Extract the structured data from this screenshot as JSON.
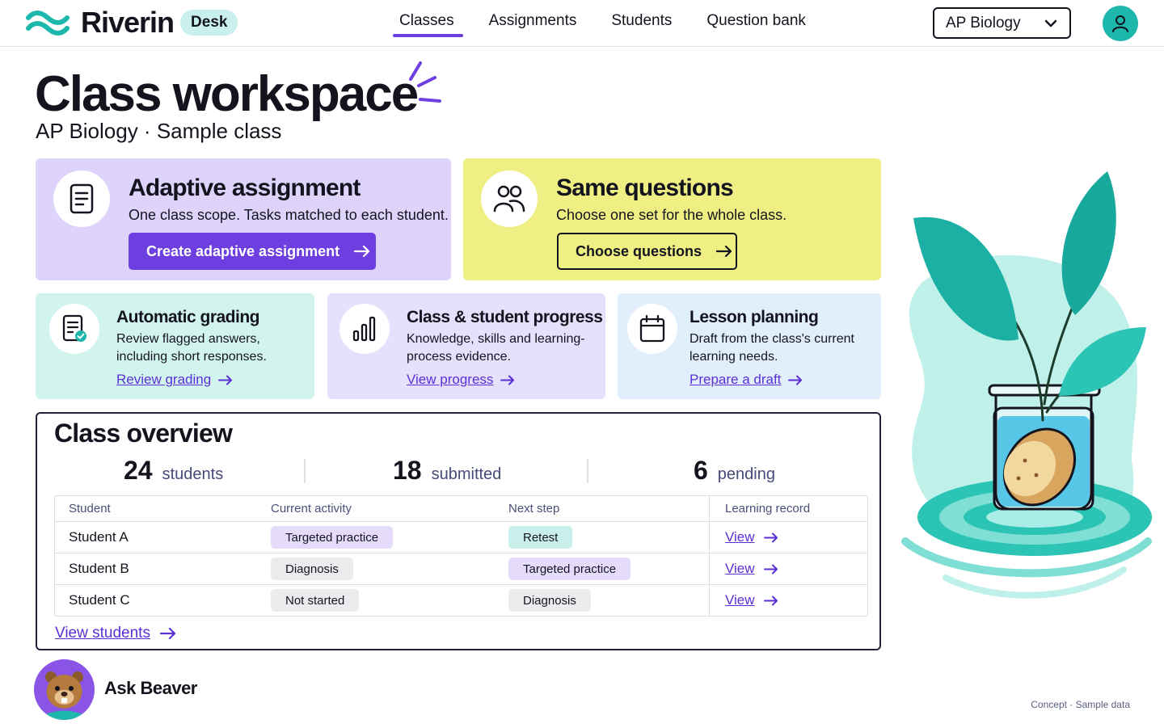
{
  "brand": {
    "name": "Riverin",
    "badge": "Desk"
  },
  "nav": {
    "items": [
      {
        "label": "Classes",
        "active": true
      },
      {
        "label": "Assignments",
        "active": false
      },
      {
        "label": "Students",
        "active": false
      },
      {
        "label": "Question bank",
        "active": false
      }
    ]
  },
  "class_select": {
    "value": "AP Biology",
    "icon": "chevron-down-icon"
  },
  "account": {
    "icon": "user-icon"
  },
  "page": {
    "title": "Class workspace",
    "subtitle": "AP Biology · Sample class"
  },
  "cards": {
    "adaptive": {
      "title": "Adaptive assignment",
      "description": "One class scope. Tasks matched to each student.",
      "button": "Create adaptive assignment",
      "icon": "document-icon"
    },
    "same": {
      "title": "Same questions",
      "description": "Choose one set for the whole class.",
      "button": "Choose questions",
      "icon": "people-icon"
    },
    "grading": {
      "title": "Automatic grading",
      "description": "Review flagged answers, including short responses.",
      "link": "Review grading",
      "icon": "document-check-icon"
    },
    "progress": {
      "title": "Class & student progress",
      "description": "Knowledge, skills and learning-process evidence.",
      "link": "View progress",
      "icon": "bar-chart-icon"
    },
    "lesson": {
      "title": "Lesson planning",
      "description": "Draft from the class's current learning needs.",
      "link": "Prepare a draft",
      "icon": "calendar-icon"
    }
  },
  "overview": {
    "title": "Class overview",
    "stats": [
      {
        "value": "24",
        "label": "students"
      },
      {
        "value": "18",
        "label": "submitted"
      },
      {
        "value": "6",
        "label": "pending"
      }
    ],
    "columns": [
      "Student",
      "Current activity",
      "Next step",
      "Learning record"
    ],
    "rows": [
      {
        "student": "Student A",
        "activity": "Targeted practice",
        "next": "Retest",
        "record": "View"
      },
      {
        "student": "Student B",
        "activity": "Diagnosis",
        "next": "Targeted practice",
        "record": "View"
      },
      {
        "student": "Student C",
        "activity": "Not started",
        "next": "Diagnosis",
        "record": "View"
      }
    ],
    "footer_link": "View students"
  },
  "assistant": {
    "label": "Ask Beaver",
    "icon": "beaver-avatar-icon"
  },
  "footer": {
    "note": "Concept · Sample data"
  },
  "colors": {
    "accent": "#6d3fe0",
    "teal": "#1db8ab",
    "adaptive_card": "#ddd3fb",
    "same_card": "#f0ef84",
    "grading_card": "#d2f4ef",
    "progress_card": "#e5e0fb",
    "lesson_card": "#e1eefc"
  }
}
